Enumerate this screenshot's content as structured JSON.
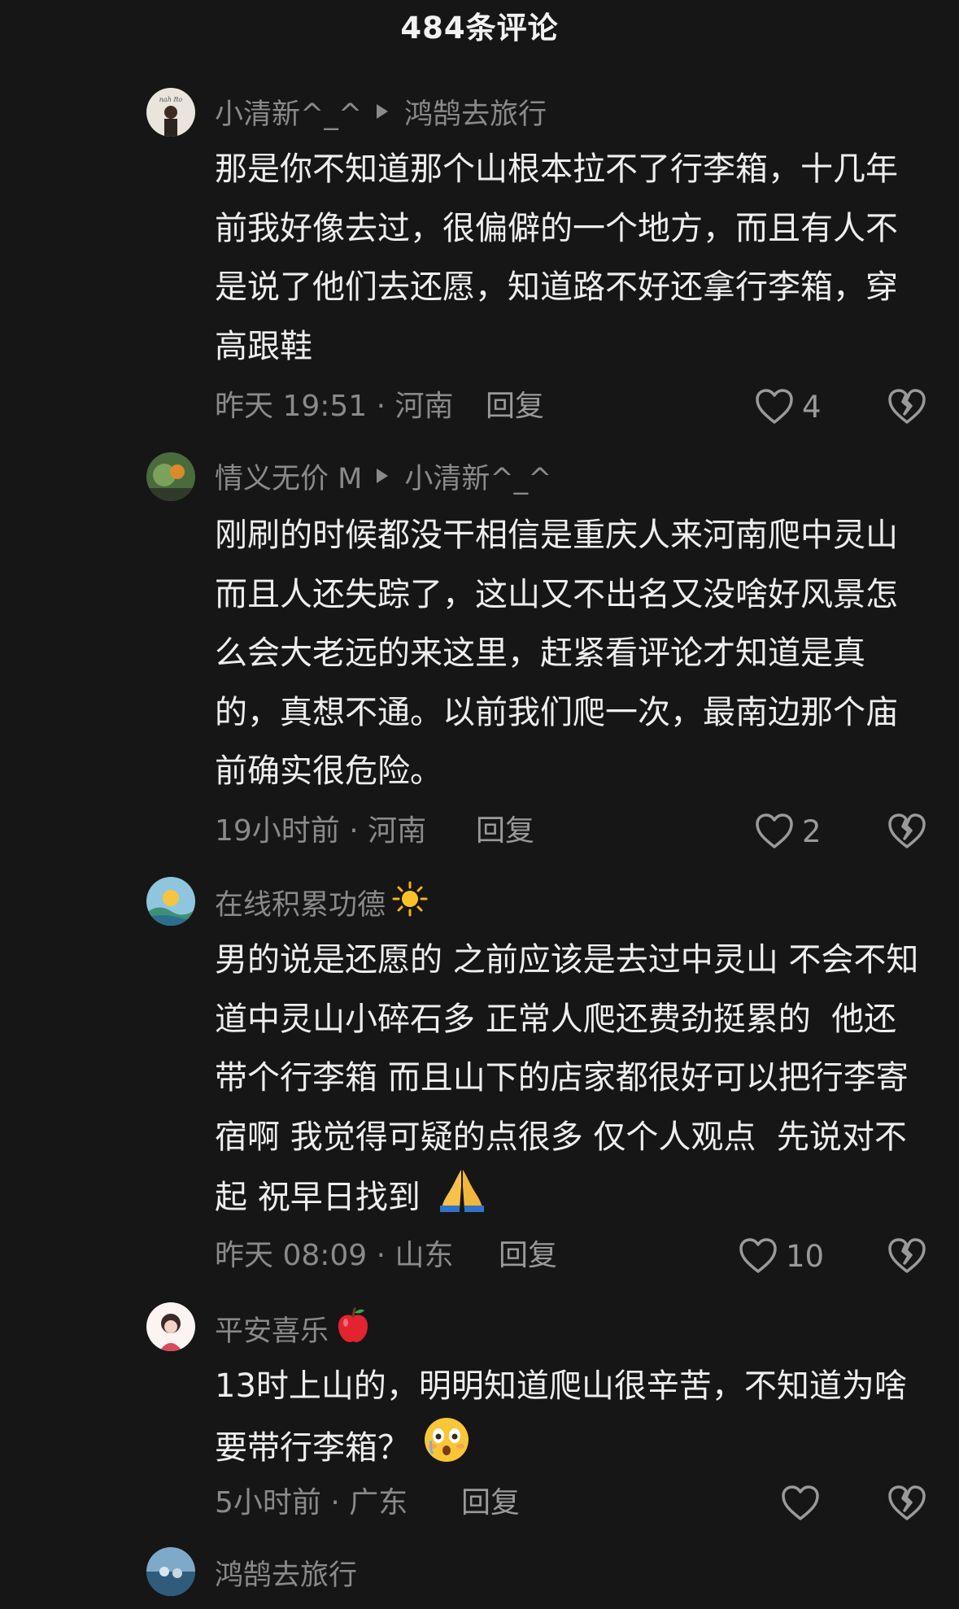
{
  "header": {
    "title": "484条评论"
  },
  "comments": [
    {
      "author": "小清新^_^",
      "reply_to": "鸿鹄去旅行",
      "author_emoji": "",
      "text": "那是你不知道那个山根本拉不了行李箱，十几年前我好像去过，很偏僻的一个地方，而且有人不是说了他们去还愿，知道路不好还拿行李箱，穿高跟鞋",
      "time": "昨天 19:51 · 河南",
      "reply_label": "回复",
      "likes": "4"
    },
    {
      "author": "情义无价 M",
      "reply_to": "小清新^_^",
      "author_emoji": "",
      "text": "刚刷的时候都没干相信是重庆人来河南爬中灵山而且人还失踪了，这山又不出名又没啥好风景怎么会大老远的来这里，赶紧看评论才知道是真的，真想不通。以前我们爬一次，最南边那个庙前确实很危险。",
      "time": "19小时前 · 河南",
      "reply_label": "回复",
      "likes": "2"
    },
    {
      "author": "在线积累功德",
      "reply_to": "",
      "author_emoji": "sun-emoji",
      "text": "男的说是还愿的 之前应该是去过中灵山 不会不知道中灵山小碎石多 正常人爬还费劲挺累的  他还带个行李箱 而且山下的店家都很好可以把行李寄宿啊 我觉得可疑的点很多 仅个人观点  先说对不起 祝早日找到",
      "time": "昨天 08:09 · 山东",
      "reply_label": "回复",
      "likes": "10"
    },
    {
      "author": "平安喜乐",
      "reply_to": "",
      "author_emoji": "apple-emoji",
      "text": "13时上山的，明明知道爬山很辛苦，不知道为啥要带行李箱？",
      "time": "5小时前 · 广东",
      "reply_label": "回复",
      "likes": ""
    },
    {
      "author": "鸿鹄去旅行",
      "reply_to": "",
      "author_emoji": "",
      "text": "",
      "time": "",
      "reply_label": "",
      "likes": ""
    }
  ],
  "colors": {
    "background": "#161616",
    "text_primary": "#eeeeee",
    "text_secondary": "#8a8a8a"
  },
  "icons": {
    "like": "heart-outline-icon",
    "dislike": "broken-heart-icon",
    "reply_arrow": "triangle-right-icon"
  }
}
